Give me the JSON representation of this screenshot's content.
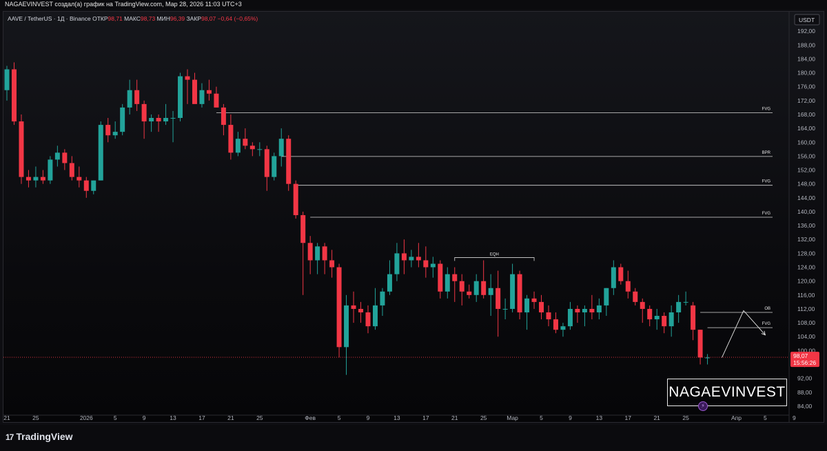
{
  "header": {
    "title": "NAGAEVINVEST создал(а) график на TradingView.com, Мар 28, 2026 11:03 UTC+3"
  },
  "legend": {
    "symbol": "AAVE / TetherUS · 1Д · Binance",
    "open_label": "ОТКР",
    "open": "98,71",
    "high_label": "МАКС",
    "high": "98,73",
    "low_label": "МИН",
    "low": "96,39",
    "close_label": "ЗАКР",
    "close": "98,07",
    "change": "−0,64 (−0,65%)"
  },
  "currency": "USDT",
  "price_tag": {
    "price": "98,07",
    "countdown": "15:56:26"
  },
  "watermark": "NAGAEVINVEST",
  "footer": {
    "logo_mark": "17",
    "logo_text": "TradingView"
  },
  "colors": {
    "up": "#22a39a",
    "down": "#f23645",
    "level_line": "#d9d9d9",
    "bg": "#0e0e12",
    "price_line": "#f23645"
  },
  "chart_data": {
    "type": "candlestick",
    "ylim": [
      82,
      196
    ],
    "y_ticks": [
      "84,00",
      "88,00",
      "92,00",
      "96,00",
      "100,00",
      "104,00",
      "108,00",
      "112,00",
      "116,00",
      "120,00",
      "124,00",
      "128,00",
      "132,00",
      "136,00",
      "140,00",
      "144,00",
      "148,00",
      "152,00",
      "156,00",
      "160,00",
      "164,00",
      "168,00",
      "172,00",
      "176,00",
      "180,00",
      "184,00",
      "188,00",
      "192,00"
    ],
    "x_ticks": [
      {
        "label": "21",
        "i": 0
      },
      {
        "label": "25",
        "i": 4
      },
      {
        "label": "2026",
        "i": 11
      },
      {
        "label": "5",
        "i": 15
      },
      {
        "label": "9",
        "i": 19
      },
      {
        "label": "13",
        "i": 23
      },
      {
        "label": "17",
        "i": 27
      },
      {
        "label": "21",
        "i": 31
      },
      {
        "label": "25",
        "i": 35
      },
      {
        "label": "Фев",
        "i": 42
      },
      {
        "label": "5",
        "i": 46
      },
      {
        "label": "9",
        "i": 50
      },
      {
        "label": "13",
        "i": 54
      },
      {
        "label": "17",
        "i": 58
      },
      {
        "label": "21",
        "i": 62
      },
      {
        "label": "25",
        "i": 66
      },
      {
        "label": "Мар",
        "i": 70
      },
      {
        "label": "5",
        "i": 74
      },
      {
        "label": "9",
        "i": 78
      },
      {
        "label": "13",
        "i": 82
      },
      {
        "label": "17",
        "i": 86
      },
      {
        "label": "21",
        "i": 90
      },
      {
        "label": "25",
        "i": 94
      },
      {
        "label": "Апр",
        "i": 101
      },
      {
        "label": "5",
        "i": 105
      },
      {
        "label": "9",
        "i": 109
      }
    ],
    "candles": [
      [
        175,
        182,
        172,
        181
      ],
      [
        181,
        183,
        165,
        166
      ],
      [
        166,
        168,
        148,
        150
      ],
      [
        150,
        152,
        147,
        149
      ],
      [
        149,
        153,
        147,
        150
      ],
      [
        150,
        152,
        148,
        149
      ],
      [
        149,
        156,
        148,
        155
      ],
      [
        155,
        159,
        153,
        157
      ],
      [
        157,
        158,
        152,
        154
      ],
      [
        154,
        156,
        149,
        150
      ],
      [
        150,
        153,
        147,
        149
      ],
      [
        149,
        150,
        144,
        146
      ],
      [
        146,
        149,
        145,
        149
      ],
      [
        149,
        166,
        149,
        165
      ],
      [
        165,
        167,
        160,
        162
      ],
      [
        162,
        166,
        161,
        163
      ],
      [
        163,
        171,
        162,
        170
      ],
      [
        170,
        178,
        168,
        175
      ],
      [
        175,
        178,
        169,
        171
      ],
      [
        171,
        172,
        161,
        166
      ],
      [
        166,
        168,
        163,
        167
      ],
      [
        167,
        168,
        163,
        166
      ],
      [
        166,
        171,
        165,
        167
      ],
      [
        167,
        169,
        160,
        167
      ],
      [
        167,
        180,
        166,
        179
      ],
      [
        179,
        181,
        171,
        178
      ],
      [
        178,
        180,
        172,
        171
      ],
      [
        171,
        177,
        170,
        175
      ],
      [
        175,
        178,
        172,
        174
      ],
      [
        174,
        176,
        170,
        170
      ],
      [
        170,
        171,
        162,
        165
      ],
      [
        165,
        168,
        155,
        157
      ],
      [
        157,
        163,
        156,
        161
      ],
      [
        161,
        164,
        158,
        159
      ],
      [
        159,
        160,
        156,
        158
      ],
      [
        158,
        160,
        156,
        158
      ],
      [
        158,
        159,
        146,
        150
      ],
      [
        150,
        157,
        149,
        156
      ],
      [
        156,
        164,
        153,
        161
      ],
      [
        161,
        162,
        146,
        148
      ],
      [
        148,
        149,
        138,
        139
      ],
      [
        139,
        140,
        116,
        131
      ],
      [
        131,
        133,
        122,
        126
      ],
      [
        126,
        131,
        122,
        130
      ],
      [
        130,
        131,
        122,
        126
      ],
      [
        126,
        129,
        121,
        124
      ],
      [
        124,
        125,
        98,
        101
      ],
      [
        101,
        116,
        93,
        113
      ],
      [
        113,
        117,
        108,
        112
      ],
      [
        112,
        114,
        108,
        111
      ],
      [
        111,
        113,
        105,
        107
      ],
      [
        107,
        118,
        106,
        113
      ],
      [
        113,
        118,
        110,
        117
      ],
      [
        117,
        126,
        116,
        122
      ],
      [
        122,
        131,
        120,
        128
      ],
      [
        128,
        132,
        122,
        126
      ],
      [
        126,
        129,
        124,
        127
      ],
      [
        127,
        131,
        124,
        126
      ],
      [
        126,
        130,
        121,
        124
      ],
      [
        124,
        127,
        121,
        125
      ],
      [
        125,
        126,
        115,
        117
      ],
      [
        117,
        124,
        115,
        122
      ],
      [
        122,
        124,
        114,
        120
      ],
      [
        120,
        122,
        113,
        117
      ],
      [
        117,
        119,
        115,
        116
      ],
      [
        116,
        122,
        114,
        120
      ],
      [
        120,
        126,
        115,
        116
      ],
      [
        116,
        122,
        110,
        118
      ],
      [
        118,
        123,
        104,
        112
      ],
      [
        112,
        115,
        109,
        112
      ],
      [
        112,
        125,
        111,
        122
      ],
      [
        122,
        123,
        109,
        111
      ],
      [
        111,
        116,
        106,
        115
      ],
      [
        115,
        117,
        112,
        114
      ],
      [
        114,
        116,
        109,
        111
      ],
      [
        111,
        113,
        107,
        109
      ],
      [
        109,
        111,
        105,
        106
      ],
      [
        106,
        108,
        104,
        107
      ],
      [
        107,
        114,
        106,
        112
      ],
      [
        112,
        113,
        108,
        111
      ],
      [
        111,
        113,
        107,
        112
      ],
      [
        112,
        116,
        109,
        111
      ],
      [
        111,
        115,
        109,
        113
      ],
      [
        113,
        118,
        110,
        118
      ],
      [
        118,
        126,
        116,
        124
      ],
      [
        124,
        125,
        119,
        120
      ],
      [
        120,
        123,
        115,
        117
      ],
      [
        117,
        118,
        113,
        114
      ],
      [
        114,
        115,
        108,
        112
      ],
      [
        112,
        113,
        107,
        109
      ],
      [
        109,
        112,
        106,
        110
      ],
      [
        110,
        111,
        105,
        107
      ],
      [
        107,
        113,
        104,
        111
      ],
      [
        111,
        116,
        108,
        114
      ],
      [
        114,
        117,
        113,
        114
      ],
      [
        113,
        114,
        103,
        106
      ],
      [
        106,
        106,
        96,
        98
      ],
      [
        98,
        99,
        96,
        98
      ]
    ],
    "levels": [
      {
        "label": "FVG",
        "price": 168.5,
        "from_i": 29
      },
      {
        "label": "BPR",
        "price": 155.9,
        "from_i": 38
      },
      {
        "label": "FVG",
        "price": 147.6,
        "from_i": 40
      },
      {
        "label": "FVG",
        "price": 138.4,
        "from_i": 42
      },
      {
        "label": "OB",
        "price": 111.0,
        "from_i": 96
      },
      {
        "label": "FVG",
        "price": 106.6,
        "from_i": 97
      }
    ],
    "eqh": {
      "label": "EQH",
      "price": 126.8,
      "from_i": 62,
      "to_i": 73
    },
    "projection": [
      [
        99,
        98
      ],
      [
        102,
        111.5
      ],
      [
        105,
        104.5
      ]
    ],
    "current_price": 98.07
  }
}
